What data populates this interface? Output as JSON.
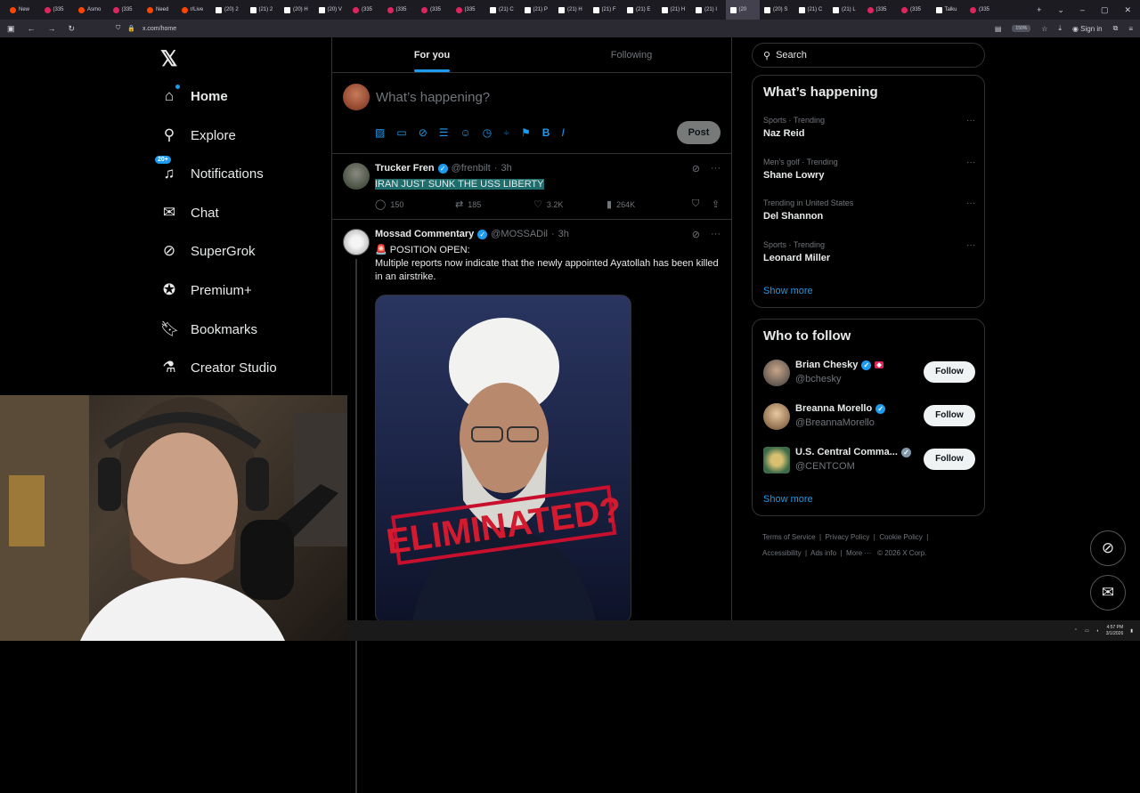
{
  "browser": {
    "tabs": [
      {
        "label": "New",
        "icon": "reddit-icon"
      },
      {
        "label": "(335",
        "icon": "youtube-icon"
      },
      {
        "label": "Asmo",
        "icon": "reddit-icon"
      },
      {
        "label": "(335",
        "icon": "youtube-icon"
      },
      {
        "label": "Need",
        "icon": "reddit-icon"
      },
      {
        "label": "r/Live",
        "icon": "reddit-icon"
      },
      {
        "label": "(20) 2",
        "icon": "x-icon"
      },
      {
        "label": "(21) 2",
        "icon": "x-icon"
      },
      {
        "label": "(20) H",
        "icon": "x-icon"
      },
      {
        "label": "(20) V",
        "icon": "x-icon"
      },
      {
        "label": "(335",
        "icon": "youtube-icon"
      },
      {
        "label": "(335",
        "icon": "youtube-icon"
      },
      {
        "label": "(335",
        "icon": "youtube-icon"
      },
      {
        "label": "(335",
        "icon": "youtube-icon"
      },
      {
        "label": "(21) C",
        "icon": "x-icon"
      },
      {
        "label": "(21) P",
        "icon": "x-icon"
      },
      {
        "label": "(21) H",
        "icon": "x-icon"
      },
      {
        "label": "(21) F",
        "icon": "x-icon"
      },
      {
        "label": "(21) E",
        "icon": "x-icon"
      },
      {
        "label": "(21) H",
        "icon": "x-icon"
      },
      {
        "label": "(21) I",
        "icon": "x-icon"
      },
      {
        "label": "(20",
        "icon": "x-icon",
        "active": true
      },
      {
        "label": "(20) S",
        "icon": "x-icon"
      },
      {
        "label": "(21) C",
        "icon": "x-icon"
      },
      {
        "label": "(21) L",
        "icon": "x-icon"
      },
      {
        "label": "(335",
        "icon": "youtube-icon"
      },
      {
        "label": "(335",
        "icon": "youtube-icon"
      },
      {
        "label": "Talku",
        "icon": "x-icon"
      },
      {
        "label": "(335",
        "icon": "youtube-icon"
      }
    ],
    "url": "x.com/home",
    "zoom": "150%",
    "sign_in": "Sign in"
  },
  "nav": {
    "items": [
      {
        "label": "Home",
        "icon": "home-icon"
      },
      {
        "label": "Explore",
        "icon": "search-icon"
      },
      {
        "label": "Notifications",
        "icon": "bell-icon",
        "badge": "20+"
      },
      {
        "label": "Chat",
        "icon": "mail-icon"
      },
      {
        "label": "SuperGrok",
        "icon": "grok-icon"
      },
      {
        "label": "Premium+",
        "icon": "verified-icon"
      },
      {
        "label": "Bookmarks",
        "icon": "bookmark-icon"
      },
      {
        "label": "Creator Studio",
        "icon": "flask-icon"
      }
    ]
  },
  "feed": {
    "tabs": [
      "For you",
      "Following"
    ],
    "compose_placeholder": "What’s happening?",
    "post_label": "Post",
    "tweets": [
      {
        "name": "Trucker Fren",
        "handle": "@frenbilt",
        "time": "3h",
        "text": "IRAN JUST SUNK THE USS LIBERTY",
        "replies": "150",
        "reposts": "185",
        "likes": "3.2K",
        "views": "264K"
      },
      {
        "name": "Mossad Commentary",
        "handle": "@MOSSADil",
        "time": "3h",
        "line1": "🚨 POSITION OPEN:",
        "line2": "Multiple reports now indicate that the newly appointed Ayatollah has been killed in an airstrike.",
        "image_caption": "ELIMINATED?"
      }
    ]
  },
  "right": {
    "search_placeholder": "Search",
    "happening_title": "What’s happening",
    "trends": [
      {
        "meta": "Sports · Trending",
        "name": "Naz Reid"
      },
      {
        "meta": "Men's golf · Trending",
        "name": "Shane Lowry"
      },
      {
        "meta": "Trending in United States",
        "name": "Del Shannon"
      },
      {
        "meta": "Sports · Trending",
        "name": "Leonard Miller"
      }
    ],
    "show_more": "Show more",
    "who_to_follow_title": "Who to follow",
    "follow": [
      {
        "name": "Brian Chesky",
        "handle": "@bchesky"
      },
      {
        "name": "Breanna Morello",
        "handle": "@BreannaMorello"
      },
      {
        "name": "U.S. Central Comma...",
        "handle": "@CENTCOM"
      }
    ],
    "follow_label": "Follow",
    "footer": [
      "Terms of Service",
      "Privacy Policy",
      "Cookie Policy",
      "Accessibility",
      "Ads info",
      "More ···",
      "© 2026 X Corp."
    ]
  },
  "taskbar": {
    "time": "4:57 PM",
    "date": "3/1/2026"
  },
  "colors": {
    "accent": "#1d9bf0",
    "bg": "#000000",
    "border": "#2f3336",
    "muted": "#71767b",
    "highlight": "#1e6e6e"
  }
}
